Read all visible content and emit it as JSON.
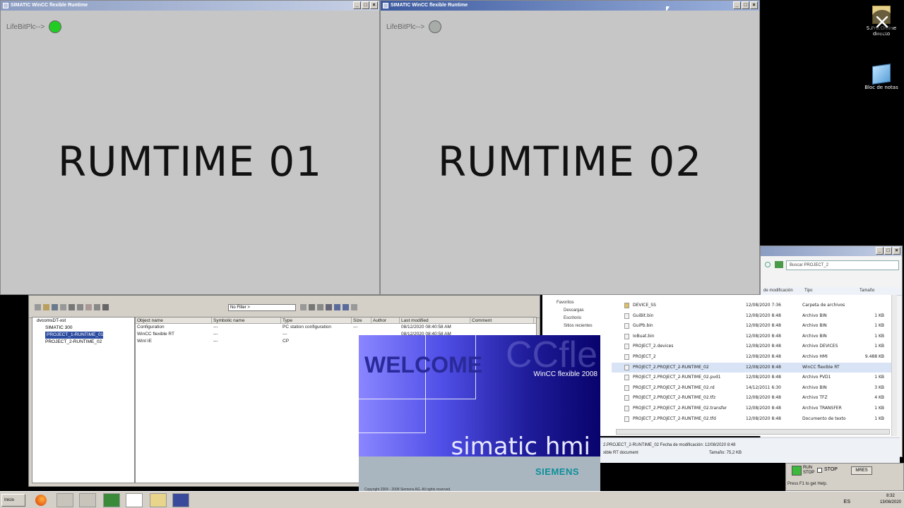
{
  "desktop": {
    "icon1_label": "S.Pro.Online\ndirecto",
    "icon2_label": "Bloc de notas"
  },
  "runtime1": {
    "title": "SIMATIC WinCC flexible Runtime",
    "lifebit_label": "LifeBitPlc-->",
    "led_color": "#22cc22",
    "main_text": "RUMTIME 01"
  },
  "runtime2": {
    "title": "SIMATIC WinCC flexible Runtime",
    "lifebit_label": "LifeBitPlc-->",
    "led_color": "#a8aca8",
    "main_text": "RUMTIME 02"
  },
  "explorer": {
    "search_placeholder": "Buscar PROJECT_2",
    "col_modified": "de modificación",
    "col_type": "Tipo",
    "col_size": "Tamaño",
    "nav_items": [
      "Favoritos",
      "Descargas",
      "Escritorio",
      "Sitios recientes"
    ],
    "files": [
      {
        "name": "DEVICE_SS",
        "date": "12/08/2020 7:36",
        "type": "Carpeta de archivos",
        "size": ""
      },
      {
        "name": "GuiBit.bin",
        "date": "12/08/2020 8:48",
        "type": "Archivo BIN",
        "size": "1 KB"
      },
      {
        "name": "GuiPb.bin",
        "date": "12/08/2020 8:48",
        "type": "Archivo BIN",
        "size": "1 KB"
      },
      {
        "name": "IoBuat.bin",
        "date": "12/08/2020 8:48",
        "type": "Archivo BIN",
        "size": "1 KB"
      },
      {
        "name": "PROJECT_2.devices",
        "date": "12/08/2020 8:48",
        "type": "Archivo DEVICES",
        "size": "1 KB"
      },
      {
        "name": "PROJECT_2",
        "date": "12/08/2020 8:48",
        "type": "Archivo HMI",
        "size": "9.488 KB"
      },
      {
        "name": "PROJECT_2.PROJECT_2-RUNTIME_02",
        "date": "12/08/2020 8:48",
        "type": "WinCC flexible RT",
        "size": ""
      },
      {
        "name": "PROJECT_2.PROJECT_2-RUNTIME_02.pvd1",
        "date": "12/08/2020 8:48",
        "type": "Archivo PVD1",
        "size": "1 KB"
      },
      {
        "name": "PROJECT_2.PROJECT_2-RUNTIME_02.rd",
        "date": "14/12/2011 6:30",
        "type": "Archivo BIN",
        "size": "3 KB"
      },
      {
        "name": "PROJECT_2.PROJECT_2-RUNTIME_02.tfz",
        "date": "12/08/2020 8:48",
        "type": "Archivo TFZ",
        "size": "4 KB"
      },
      {
        "name": "PROJECT_2.PROJECT_2-RUNTIME_02.transfer",
        "date": "12/08/2020 8:48",
        "type": "Archivo TRANSFER",
        "size": "1 KB"
      },
      {
        "name": "PROJECT_2.PROJECT_2-RUNTIME_02.tfd",
        "date": "12/08/2020 8:48",
        "type": "Documento de texto",
        "size": "1 KB"
      }
    ],
    "details_line1": "2.PROJECT_2-RUNTIME_02  Fecha de modificación: 12/08/2020 8:48",
    "details_line2": "xible RT document",
    "details_size": "Tamaño: 75,2 KB"
  },
  "manager": {
    "filter": "No Filter >",
    "tree": {
      "root": "dvcomsDT-xst",
      "items": [
        "SIMATIC 300",
        "PROJECT_1-RUNTIME_01",
        "PROJECT_2-RUNTIME_02"
      ]
    },
    "columns": [
      "Object name",
      "Symbolic name",
      "Type",
      "Size",
      "Author",
      "Last modified",
      "Comment"
    ],
    "rows": [
      {
        "name": "Configuration",
        "sym": "---",
        "type": "PC station configuration",
        "size": "---",
        "modified": "08/12/2020 08:40:58 AM"
      },
      {
        "name": "WinCC flexible RT",
        "sym": "---",
        "type": "---",
        "size": "",
        "modified": "08/12/2020 08:40:58 AM"
      },
      {
        "name": "WinI IE",
        "sym": "---",
        "type": "CP",
        "size": "",
        "modified": ""
      }
    ]
  },
  "splash": {
    "welcome": "WELCOME",
    "ccfle": "CCfle",
    "product": "WinCC flexible 2008",
    "simatic": "simatic hmi",
    "siemens": "SIEMENS",
    "copyright": "Copyright 2004 - 2008 Siemens AG. All rights reserved."
  },
  "plc": {
    "run": "RUN",
    "stop": "STOP",
    "label": "STOP",
    "mres": "MRES",
    "status": "Press F1 to get Help."
  },
  "taskbar": {
    "start": "Inicio",
    "lang": "ES",
    "time": "8:32",
    "date": "13/08/2020"
  },
  "colors": {
    "titlebar_active": "#3c5aa0",
    "runtime_bg": "#c6c6c6",
    "siemens_teal": "#0c8f9a"
  }
}
